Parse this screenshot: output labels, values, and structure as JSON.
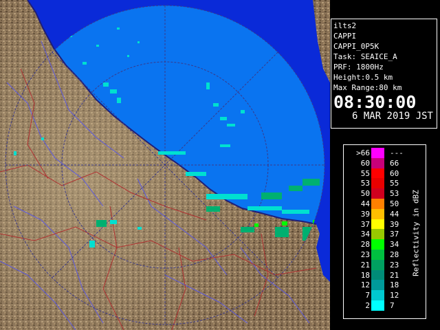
{
  "info": {
    "station": "ilts2",
    "product": "CAPPI",
    "product_id": "CAPPI_0P5K",
    "task": "Task: SEAICE_A",
    "prf": "PRF: 1800Hz",
    "height": "Height:0.5 km",
    "max_range": "Max Range:80 km",
    "time": "08:30:00",
    "date": "6 MAR 2019 JST"
  },
  "legend": {
    "label": "Reflectivity in dBZ",
    "rows": [
      {
        "lo": ">66",
        "hi": "---",
        "color": "#ff00ff"
      },
      {
        "lo": "60",
        "hi": "66",
        "color": "#c8007a"
      },
      {
        "lo": "55",
        "hi": "60",
        "color": "#ff0000"
      },
      {
        "lo": "53",
        "hi": "55",
        "color": "#e80000"
      },
      {
        "lo": "50",
        "hi": "53",
        "color": "#d0001e"
      },
      {
        "lo": "44",
        "hi": "50",
        "color": "#ff8000"
      },
      {
        "lo": "39",
        "hi": "44",
        "color": "#ffbe00"
      },
      {
        "lo": "37",
        "hi": "39",
        "color": "#ffff00"
      },
      {
        "lo": "34",
        "hi": "37",
        "color": "#98c800"
      },
      {
        "lo": "28",
        "hi": "34",
        "color": "#00ff00"
      },
      {
        "lo": "23",
        "hi": "28",
        "color": "#00c040"
      },
      {
        "lo": "21",
        "hi": "23",
        "color": "#00a060"
      },
      {
        "lo": "18",
        "hi": "21",
        "color": "#008c78"
      },
      {
        "lo": "12",
        "hi": "18",
        "color": "#009a9a"
      },
      {
        "lo": "7",
        "hi": "12",
        "color": "#00c8d0"
      },
      {
        "lo": "2",
        "hi": "7",
        "color": "#00ffff"
      }
    ]
  },
  "colors": {
    "sea": "#0a2ad8",
    "radar_coverage": "#0a74f0",
    "land": "#8a7256",
    "coast": "#1e1e78",
    "roads": "#b03030",
    "rivers": "#5a58e0"
  }
}
